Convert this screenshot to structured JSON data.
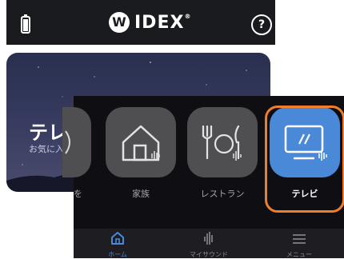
{
  "header": {
    "brand": "IDEX",
    "brand_mark": "W",
    "brand_trademark": "®",
    "help_label": "?",
    "battery_icon": "battery-icon"
  },
  "card": {
    "title": "テレビ",
    "subtitle": "お気に入り",
    "more_icon": "more-vertical-icon"
  },
  "programs": [
    {
      "label": "を",
      "icon": "partial-icon"
    },
    {
      "label": "家族",
      "icon": "home-icon"
    },
    {
      "label": "レストラン",
      "icon": "restaurant-icon"
    },
    {
      "label": "テレビ",
      "icon": "tv-icon",
      "active": true
    }
  ],
  "bottom_nav": [
    {
      "label": "ホーム",
      "icon": "home-nav-icon",
      "active": true
    },
    {
      "label": "マイサウンド",
      "icon": "sound-wave-icon"
    },
    {
      "label": "メニュー",
      "icon": "menu-icon"
    }
  ],
  "colors": {
    "accent": "#4a89d8",
    "highlight": "#ef7d2a",
    "tile": "#4f4f52",
    "panel": "#0f0f13"
  }
}
